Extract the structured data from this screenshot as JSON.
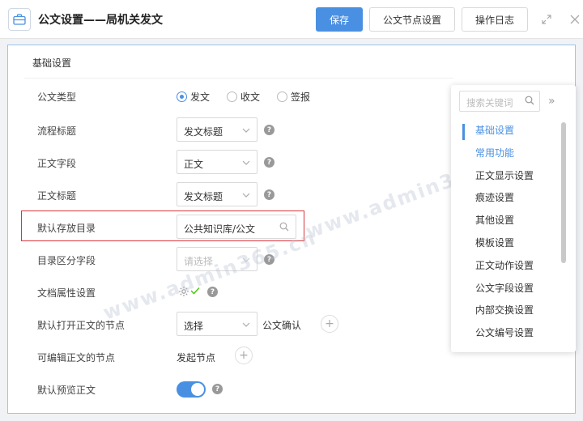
{
  "header": {
    "title": "公文设置——局机关发文",
    "save_label": "保存",
    "node_settings_label": "公文节点设置",
    "log_label": "操作日志"
  },
  "section": {
    "title": "基础设置"
  },
  "form": {
    "doc_type": {
      "label": "公文类型",
      "options": [
        "发文",
        "收文",
        "签报"
      ],
      "selected": "发文"
    },
    "flow_title": {
      "label": "流程标题",
      "value": "发文标题"
    },
    "body_field": {
      "label": "正文字段",
      "value": "正文"
    },
    "body_title": {
      "label": "正文标题",
      "value": "发文标题"
    },
    "default_dir": {
      "label": "默认存放目录",
      "value": "公共知识库/公文"
    },
    "dir_field": {
      "label": "目录区分字段",
      "placeholder": "请选择"
    },
    "attr_settings": {
      "label": "文档属性设置"
    },
    "open_body_node": {
      "label": "默认打开正文的节点",
      "value": "选择",
      "extra": "公文确认"
    },
    "editable_node": {
      "label": "可编辑正文的节点",
      "value": "发起节点"
    },
    "preview": {
      "label": "默认预览正文",
      "on": true
    }
  },
  "nav": {
    "search_placeholder": "搜索关键词",
    "items": [
      "基础设置",
      "常用功能",
      "正文显示设置",
      "痕迹设置",
      "其他设置",
      "模板设置",
      "正文动作设置",
      "公文字段设置",
      "内部交换设置",
      "公文编号设置"
    ],
    "active_index": 0
  },
  "watermark": "www.admin365.cn",
  "colors": {
    "primary": "#4a90e2",
    "highlight_border": "#d9363e",
    "success": "#52c41a"
  }
}
